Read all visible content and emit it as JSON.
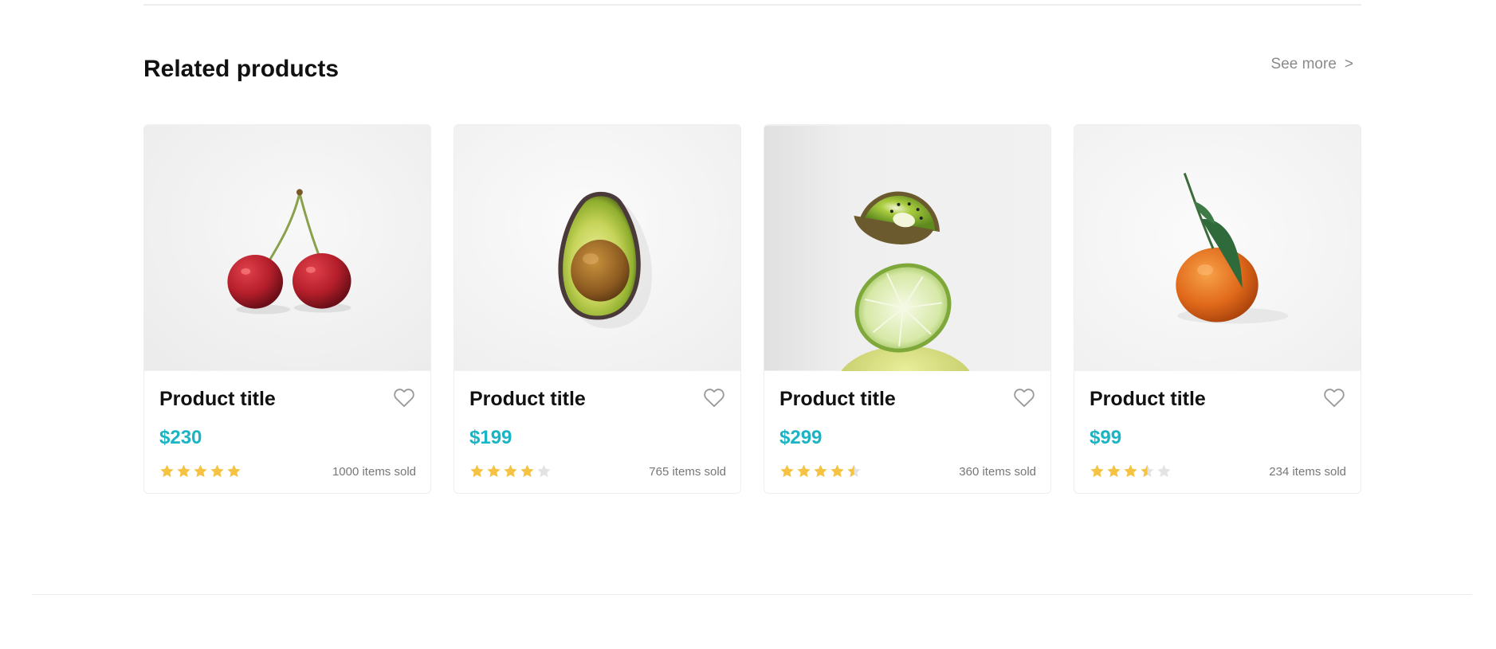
{
  "section": {
    "title": "Related products",
    "see_more": "See more",
    "see_more_icon": "chevron-right-icon"
  },
  "colors": {
    "price": "#1ab4c4",
    "star_filled": "#f5c242",
    "star_empty": "#e3e3e3",
    "heart": "#9a9a9a"
  },
  "products": [
    {
      "title": "Product title",
      "price": "$230",
      "rating": 5,
      "sold": "1000 items sold",
      "image": "cherries"
    },
    {
      "title": "Product title",
      "price": "$199",
      "rating": 4,
      "sold": "765 items sold",
      "image": "avocado"
    },
    {
      "title": "Product title",
      "price": "$299",
      "rating": 4.5,
      "sold": "360 items sold",
      "image": "kiwi-lime"
    },
    {
      "title": "Product title",
      "price": "$99",
      "rating": 3.5,
      "sold": "234 items sold",
      "image": "tangerine"
    }
  ]
}
